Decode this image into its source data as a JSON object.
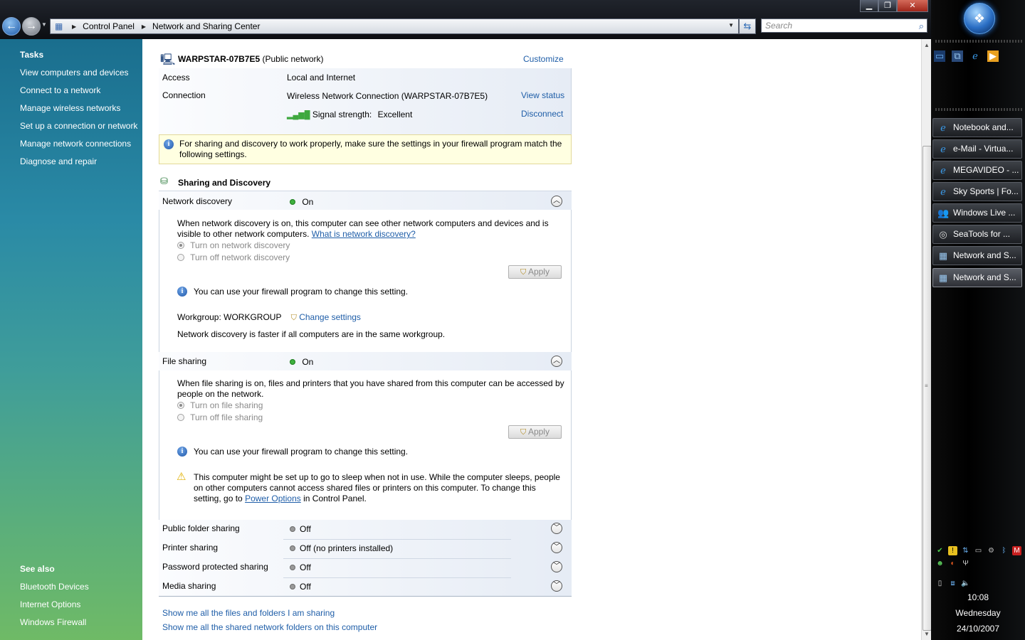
{
  "window": {
    "minimize_glyph": "▁",
    "maximize_glyph": "❐",
    "close_glyph": "✕"
  },
  "address": {
    "breadcrumb": [
      "Control Panel",
      "Network and Sharing Center"
    ],
    "search_placeholder": "Search"
  },
  "tasks": {
    "header": "Tasks",
    "items": [
      "View computers and devices",
      "Connect to a network",
      "Manage wireless networks",
      "Set up a connection or network",
      "Manage network connections",
      "Diagnose and repair"
    ]
  },
  "see_also": {
    "header": "See also",
    "items": [
      "Bluetooth Devices",
      "Internet Options",
      "Windows Firewall"
    ]
  },
  "network": {
    "name": "WARPSTAR-07B7E5",
    "type": "(Public network)",
    "customize": "Customize",
    "access_label": "Access",
    "access_value": "Local and Internet",
    "connection_label": "Connection",
    "connection_value": "Wireless Network Connection (WARPSTAR-07B7E5)",
    "view_status": "View status",
    "signal_label": "Signal strength:",
    "signal_value": "Excellent",
    "disconnect": "Disconnect"
  },
  "firewall_note": "For sharing and discovery to work properly, make sure the settings in your firewall program match the following settings.",
  "sharing": {
    "title": "Sharing and Discovery",
    "network_discovery": {
      "label": "Network discovery",
      "status": "On",
      "desc1": "When network discovery is on, this computer can see other network computers and devices and is",
      "desc2": "visible to other network computers.",
      "help_link": "What is network discovery?",
      "option_on": "Turn on network discovery",
      "option_off": "Turn off network discovery",
      "apply": "Apply",
      "firewall_info": "You can use your firewall program to change this setting.",
      "workgroup": "Workgroup: WORKGROUP",
      "change_settings": "Change settings",
      "workgroup_note": "Network discovery is faster if all computers are in the same workgroup."
    },
    "file_sharing": {
      "label": "File sharing",
      "status": "On",
      "desc1": "When file sharing is on, files and printers that you have shared from this computer can be accessed by",
      "desc2": "people on the network.",
      "option_on": "Turn on file sharing",
      "option_off": "Turn off file sharing",
      "apply": "Apply",
      "firewall_info": "You can use your firewall program to change this setting.",
      "warning1": "This computer might be set up to go to sleep when not in use. While the computer sleeps, people",
      "warning2": "on other computers cannot access shared files or printers on this computer. To change this",
      "warning3_pre": "setting, go to",
      "warning3_link": "Power Options",
      "warning3_post": "in Control Panel."
    },
    "collapsed": [
      {
        "label": "Public folder sharing",
        "status": "Off"
      },
      {
        "label": "Printer sharing",
        "status": "Off (no printers installed)"
      },
      {
        "label": "Password protected sharing",
        "status": "Off"
      },
      {
        "label": "Media sharing",
        "status": "Off"
      }
    ]
  },
  "bottom_links": [
    "Show me all the files and folders I am sharing",
    "Show me all the shared network folders on this computer"
  ],
  "taskbar": {
    "start_glyph": "❖",
    "tasks": [
      {
        "label": "Notebook and...",
        "icon": "ie-icon"
      },
      {
        "label": "e-Mail - Virtua...",
        "icon": "ie-icon"
      },
      {
        "label": "MEGAVIDEO - ...",
        "icon": "ie-icon"
      },
      {
        "label": "Sky Sports | Fo...",
        "icon": "ie-icon"
      },
      {
        "label": "Windows Live ...",
        "icon": "messenger-icon"
      },
      {
        "label": "SeaTools for ...",
        "icon": "seatools-icon"
      },
      {
        "label": "Network and S...",
        "icon": "network-center-icon"
      },
      {
        "label": "Network and S...",
        "icon": "network-center-icon"
      }
    ],
    "clock": {
      "time": "10:08",
      "day": "Wednesday",
      "date": "24/10/2007"
    }
  },
  "colors": {
    "link": "#1f5ea8",
    "info_bar": "#ffffe1",
    "status_on": "#3fb13f",
    "status_off": "#9a9a9a"
  }
}
